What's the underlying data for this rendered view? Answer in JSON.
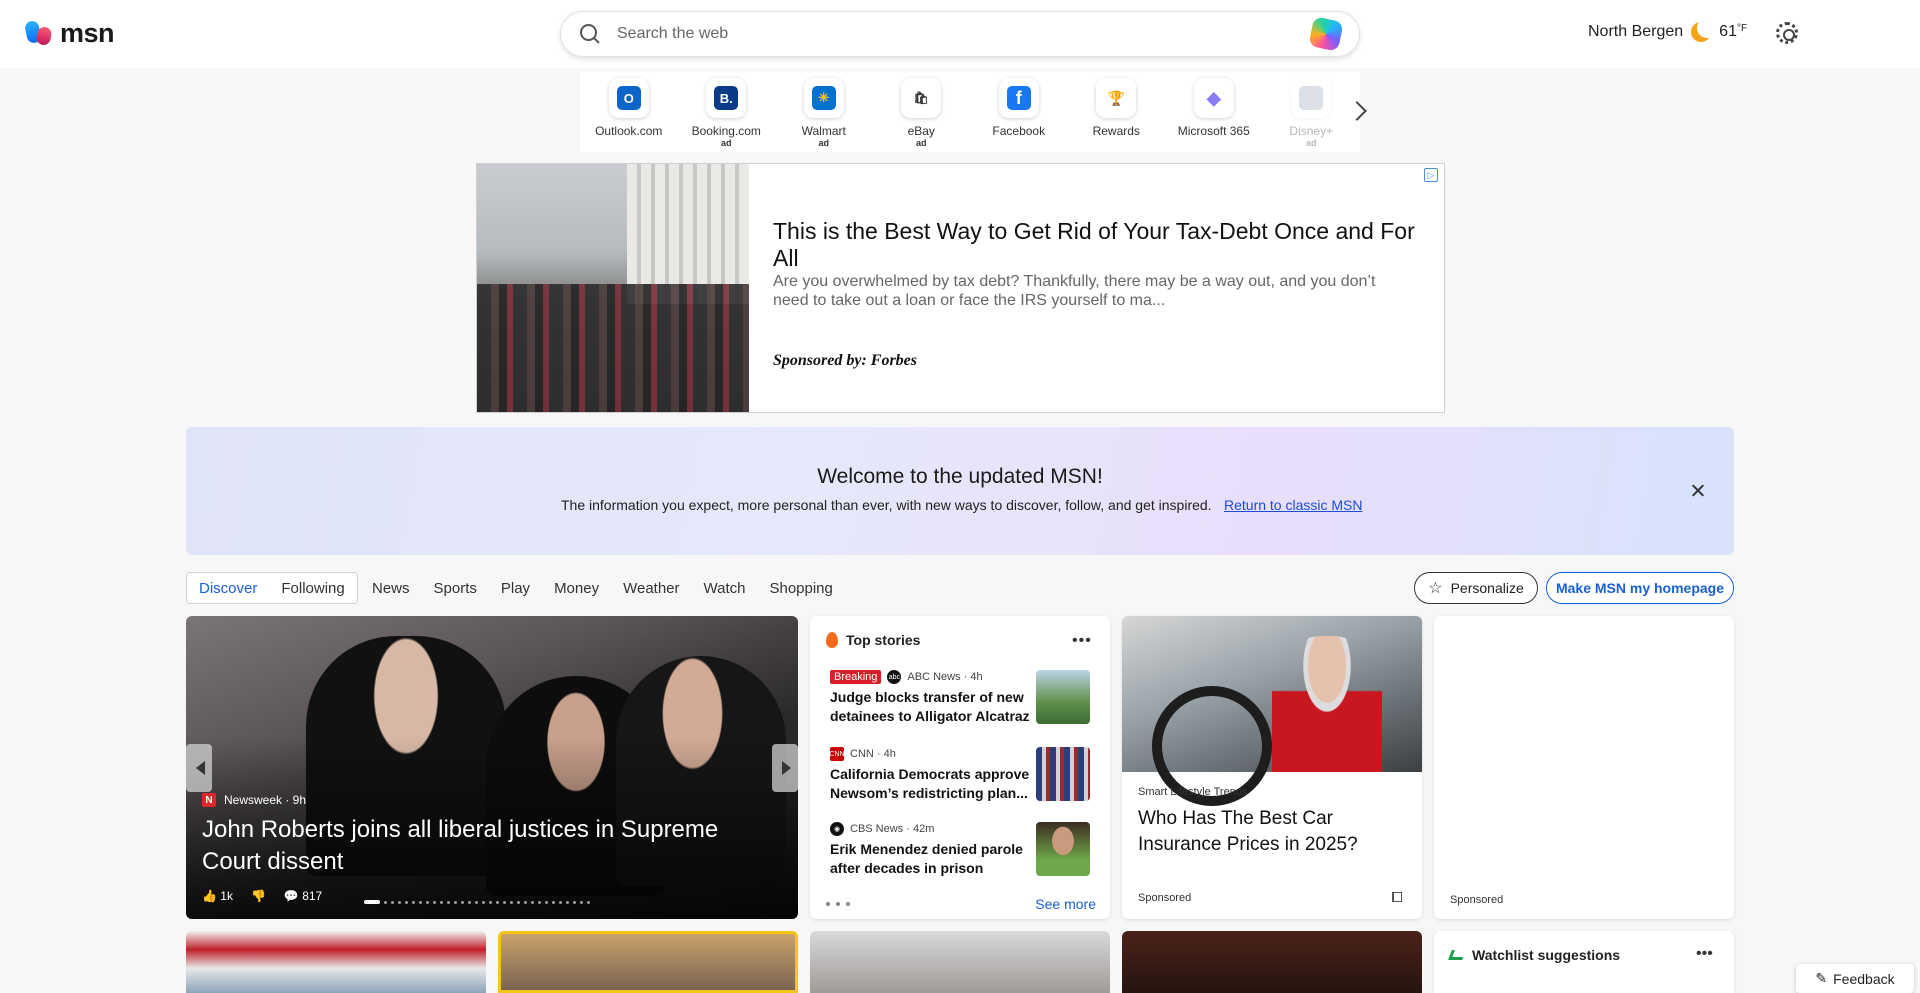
{
  "brand": {
    "logo_text": "msn"
  },
  "search": {
    "placeholder": "Search the web"
  },
  "weather": {
    "location": "North Bergen",
    "temp": "61",
    "unit": "°F"
  },
  "quick_links": [
    {
      "label": "Outlook.com",
      "ad": "",
      "icon": "outlook-icon",
      "color": "#0a64c9",
      "glyph": "O"
    },
    {
      "label": "Booking.com",
      "ad": "ad",
      "icon": "booking-icon",
      "color": "#0b3a87",
      "glyph": "B."
    },
    {
      "label": "Walmart",
      "ad": "ad",
      "icon": "walmart-icon",
      "color": "#0071ce",
      "glyph": "✳"
    },
    {
      "label": "eBay",
      "ad": "ad",
      "icon": "ebay-icon",
      "color": "#ffffff",
      "glyph": "🛍"
    },
    {
      "label": "Facebook",
      "ad": "",
      "icon": "facebook-icon",
      "color": "#1877f2",
      "glyph": "f"
    },
    {
      "label": "Rewards",
      "ad": "",
      "icon": "rewards-icon",
      "color": "#f5b400",
      "glyph": "🏆"
    },
    {
      "label": "Microsoft 365",
      "ad": "",
      "icon": "microsoft365-icon",
      "color": "#8a7cf7",
      "glyph": "◆"
    },
    {
      "label": "Disney+",
      "ad": "ad",
      "icon": "disney-icon",
      "color": "#9aa7bb",
      "glyph": ""
    }
  ],
  "ad": {
    "title": "This is the Best Way to Get Rid of Your Tax-Debt Once and For All",
    "description": "Are you overwhelmed by tax debt? Thankfully, there may be a way out, and you don’t need to take out a loan or face the IRS yourself to ma...",
    "sponsor": "Sponsored by: Forbes"
  },
  "welcome": {
    "title": "Welcome to the updated MSN!",
    "text": "The information you expect, more personal than ever, with new ways to discover, follow, and get inspired.",
    "link": "Return to classic MSN"
  },
  "nav": {
    "segment": [
      "Discover",
      "Following"
    ],
    "links": [
      "News",
      "Sports",
      "Play",
      "Money",
      "Weather",
      "Watch",
      "Shopping"
    ],
    "personalize": "Personalize",
    "homepage": "Make MSN my homepage"
  },
  "hero": {
    "source": "Newsweek · 9h",
    "title": "John Roberts joins all liberal justices in Supreme Court dissent",
    "likes": "1k",
    "comments": "817"
  },
  "top_stories": {
    "heading": "Top stories",
    "items": [
      {
        "badge": "Breaking",
        "source": "ABC News · 4h",
        "title": "Judge blocks transfer of new detainees to Alligator Alcatraz"
      },
      {
        "badge": "",
        "source": "CNN · 4h",
        "title": "California Democrats approve Newsom’s redistricting plan..."
      },
      {
        "badge": "",
        "source": "CBS News · 42m",
        "title": "Erik Menendez denied parole after decades in prison"
      }
    ],
    "see_more": "See more"
  },
  "insurance": {
    "source": "Smart Lifestyle Trends",
    "title": "Who Has The Best Car Insurance Prices in 2025?",
    "sponsored": "Sponsored"
  },
  "blank_ad": {
    "sponsored": "Sponsored"
  },
  "watchlist": {
    "heading": "Watchlist suggestions"
  },
  "feedback": "Feedback"
}
